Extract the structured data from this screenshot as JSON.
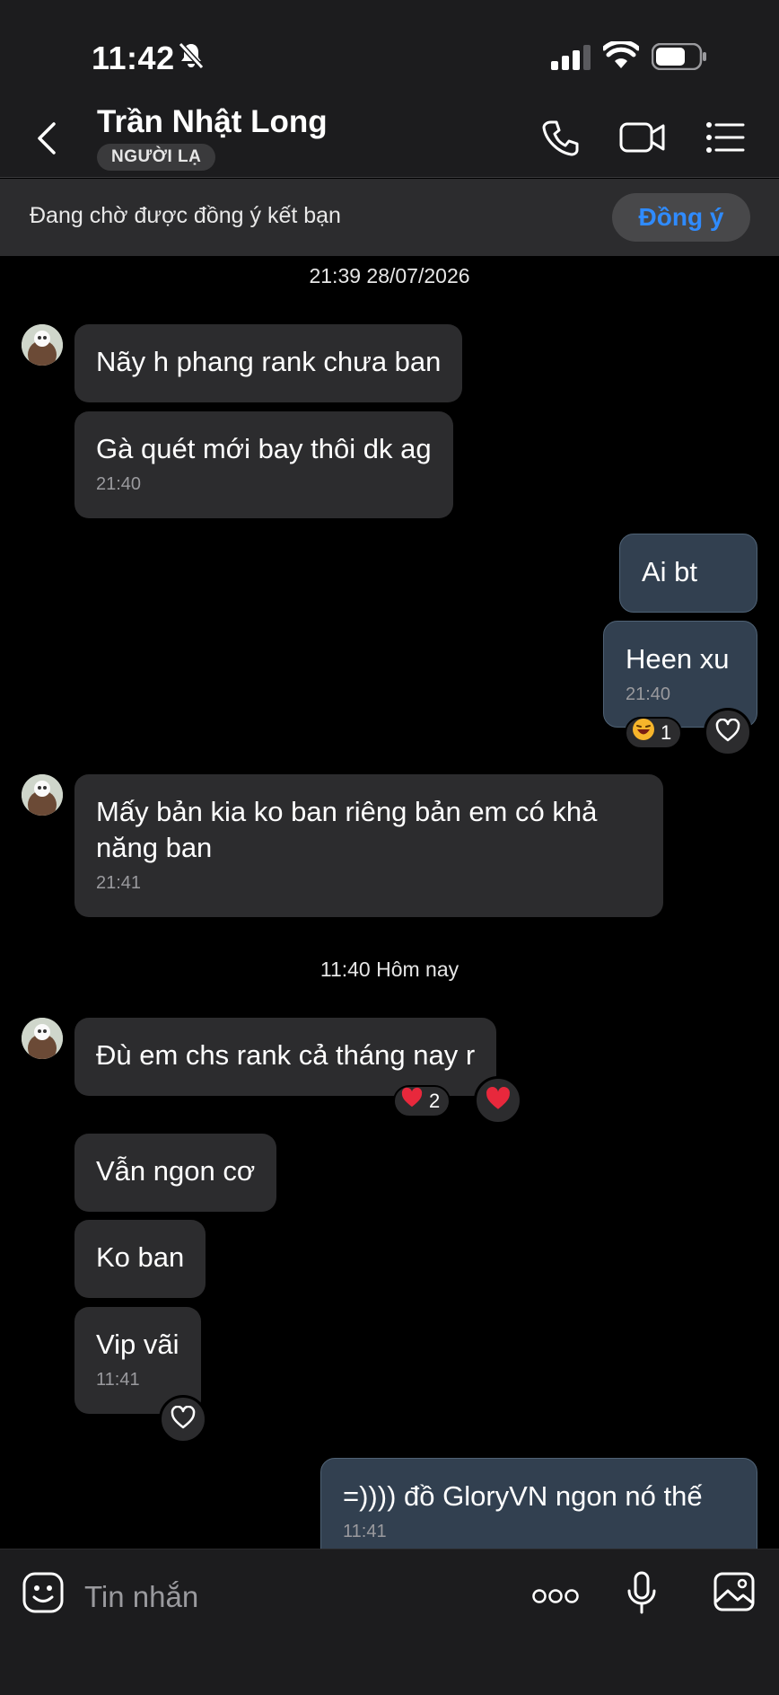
{
  "status_bar": {
    "time": "11:42"
  },
  "header": {
    "contact_name": "Trần Nhật Long",
    "badge": "NGƯỜI LẠ"
  },
  "friend_bar": {
    "text": "Đang chờ được đồng ý kết bạn",
    "accept_label": "Đồng ý"
  },
  "chat": {
    "separator_1": "21:39 28/07/2026",
    "separator_2": "11:40 Hôm nay",
    "messages": [
      {
        "text": "Nãy h phang rank chưa ban"
      },
      {
        "text": "Gà quét mới bay thôi dk ag",
        "time": "21:40"
      },
      {
        "text": "Ai bt"
      },
      {
        "text": "Heen xu",
        "time": "21:40",
        "reaction_count": "1"
      },
      {
        "text": "Mấy bản kia ko ban riêng bản em có khả năng ban",
        "time": "21:41"
      },
      {
        "text": "Đù em chs rank cả tháng nay r",
        "reaction_count": "2"
      },
      {
        "text": "Vẫn ngon cơ"
      },
      {
        "text": "Ko ban"
      },
      {
        "text": "Vip vãi",
        "time": "11:41"
      },
      {
        "text": "=)))) đồ GloryVN ngon nó thế",
        "time": "11:41"
      }
    ]
  },
  "input_bar": {
    "placeholder": "Tin nhắn"
  },
  "colors": {
    "accent": "#2f8bff",
    "incoming_bubble": "#2c2c2e",
    "outgoing_bubble": "#324050",
    "heart": "#e8283c"
  }
}
